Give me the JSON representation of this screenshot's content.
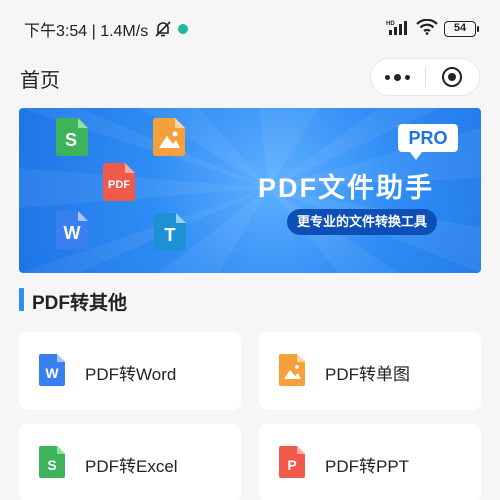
{
  "status_bar": {
    "time_speed": "下午3:54 | 1.4M/s",
    "battery": "54",
    "network": "HD"
  },
  "nav": {
    "title": "首页"
  },
  "banner": {
    "title": "PDF文件助手",
    "subtitle": "更专业的文件转换工具",
    "badge": "PRO",
    "icons": [
      {
        "letter": "S",
        "color": "#3fb35c"
      },
      {
        "letter": "PDF",
        "color": "#f05a4b"
      },
      {
        "letter": "W",
        "color": "#3a7ff0"
      },
      {
        "letter": "T",
        "color": "#1e90d6"
      }
    ],
    "image_icon_color": "#f5a03a"
  },
  "section": {
    "title": "PDF转其他"
  },
  "tiles": [
    {
      "label": "PDF转Word",
      "icon": "word-doc-icon",
      "letter": "W",
      "color": "#3a7ff0"
    },
    {
      "label": "PDF转单图",
      "icon": "image-doc-icon",
      "letter": "",
      "color": "#f5a03a"
    },
    {
      "label": "PDF转Excel",
      "icon": "excel-doc-icon",
      "letter": "S",
      "color": "#3fb35c"
    },
    {
      "label": "PDF转PPT",
      "icon": "ppt-doc-icon",
      "letter": "P",
      "color": "#f05a4b"
    }
  ]
}
